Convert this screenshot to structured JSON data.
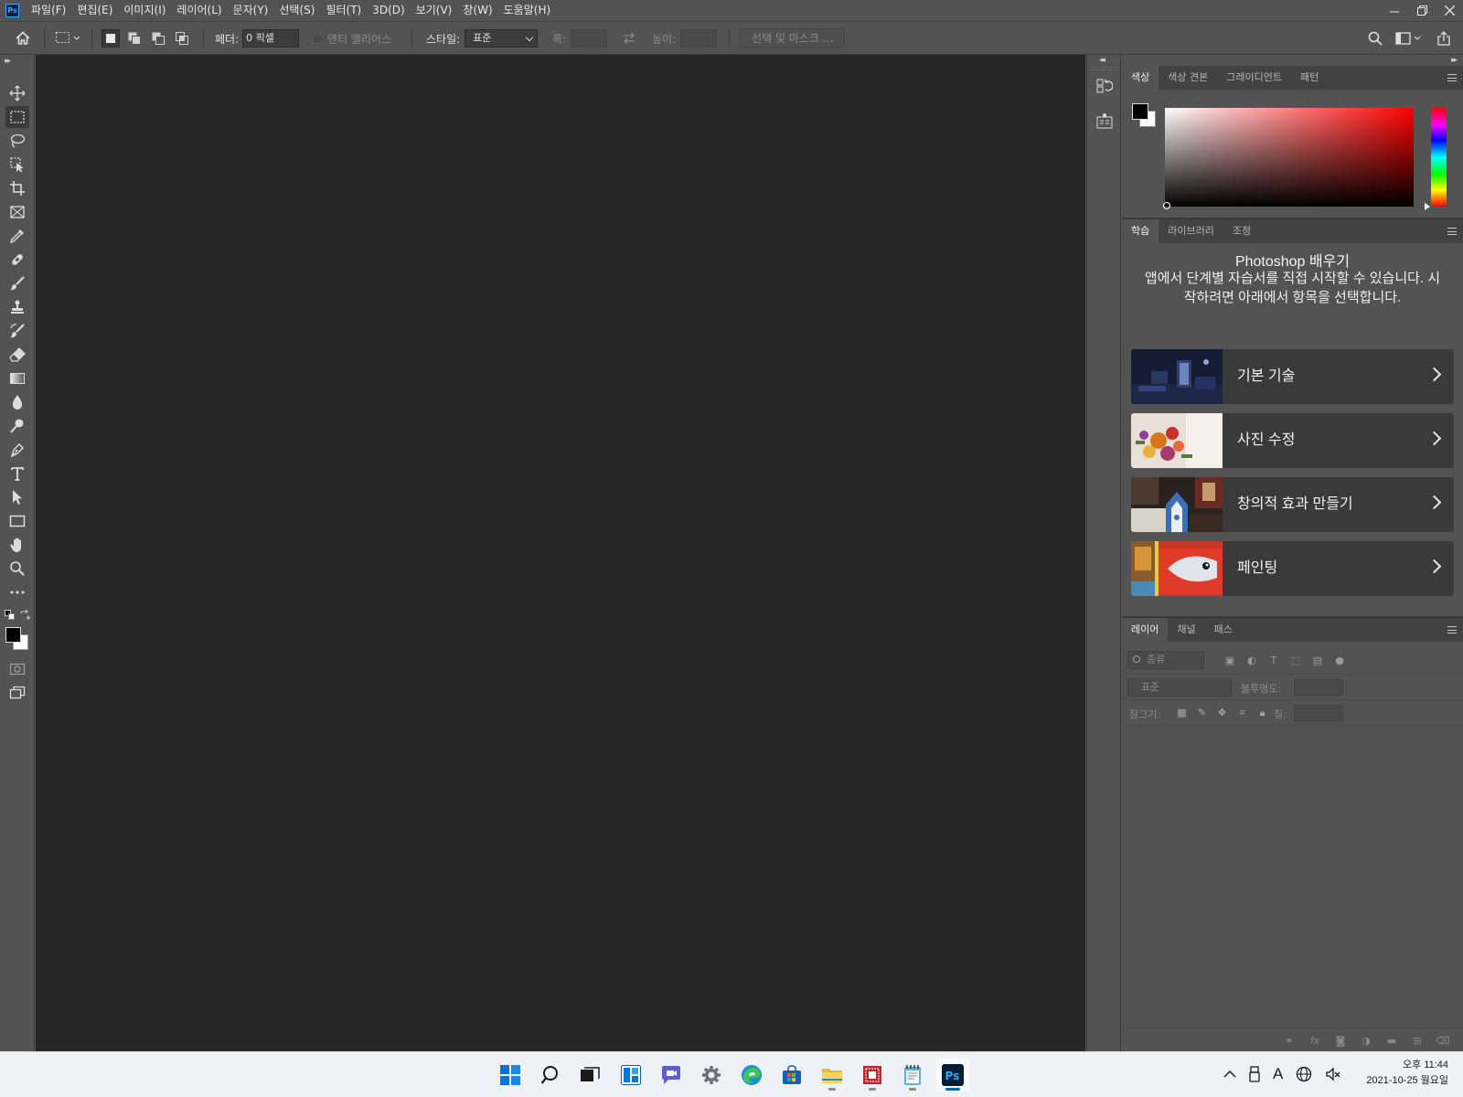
{
  "menubar": {
    "app_icon": "Ps",
    "items": [
      "파일(F)",
      "편집(E)",
      "이미지(I)",
      "레이어(L)",
      "문자(Y)",
      "선택(S)",
      "필터(T)",
      "3D(D)",
      "보기(V)",
      "창(W)",
      "도움말(H)"
    ],
    "window_controls": [
      "minimize",
      "restore",
      "close"
    ]
  },
  "optbar": {
    "feather_label": "페더:",
    "feather_value": "0 픽셀",
    "antialias_label": "앤티 앨리어스",
    "style_label": "스타일:",
    "style_value": "표준",
    "width_label": "폭:",
    "height_label": "높이:",
    "select_mask_button": "선택 및 마스크 ..."
  },
  "toolbar": {
    "tools": [
      "move-tool",
      "rectangular-marquee-tool",
      "lasso-tool",
      "object-selection-tool",
      "crop-tool",
      "frame-tool",
      "eyedropper-tool",
      "healing-brush-tool",
      "brush-tool",
      "clone-stamp-tool",
      "history-brush-tool",
      "eraser-tool",
      "gradient-tool",
      "blur-tool",
      "dodge-tool",
      "pen-tool",
      "type-tool",
      "path-selection-tool",
      "rectangle-tool",
      "hand-tool",
      "zoom-tool",
      "edit-toolbar"
    ],
    "active_tool": "rectangular-marquee-tool",
    "foreground_color": "#000000",
    "background_color": "#ffffff"
  },
  "color_panel": {
    "tabs": [
      "색상",
      "색상 견본",
      "그레이디언트",
      "패턴"
    ],
    "active_tab": "색상",
    "hue": "#ff0000"
  },
  "learn_panel": {
    "tabs": [
      "학습",
      "라이브러리",
      "조정"
    ],
    "active_tab": "학습",
    "title": "Photoshop 배우기",
    "description": "앱에서 단계별 자습서를 직접 시작할 수 있습니다. 시작하려면 아래에서 항목을 선택합니다.",
    "cards": [
      {
        "label": "기본 기술"
      },
      {
        "label": "사진 수정"
      },
      {
        "label": "창의적 효과 만들기"
      },
      {
        "label": "페인팅"
      }
    ]
  },
  "layers_panel": {
    "tabs": [
      "레이어",
      "채널",
      "패스"
    ],
    "active_tab": "레이어",
    "filter_placeholder": "종류",
    "blend_mode": "표준",
    "opacity_label": "불투명도:",
    "lock_label": "잠그기:",
    "fill_label": "칠:"
  },
  "taskbar": {
    "apps": [
      "start",
      "search",
      "task-view",
      "widgets",
      "chat",
      "settings",
      "edge",
      "store",
      "file-explorer",
      "app-red",
      "notepad",
      "photoshop"
    ],
    "active_app": "photoshop",
    "tray_ime": "A",
    "time": "오후 11:44",
    "date": "2021-10-25 월요일"
  }
}
